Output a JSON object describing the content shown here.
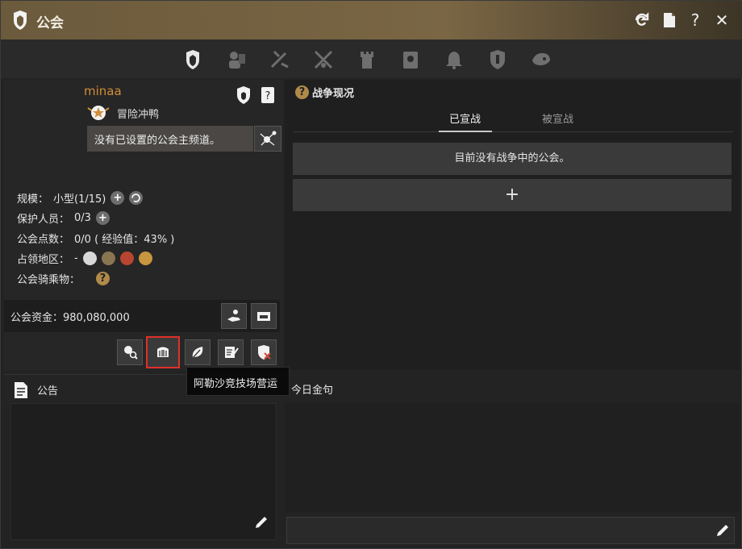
{
  "window": {
    "title": "公会"
  },
  "titlebar": {
    "buttons": [
      "refresh-icon",
      "document-icon",
      "help-icon",
      "close-icon"
    ],
    "help_label": "?",
    "close_label": "✕"
  },
  "tabs": [
    "guild-info-icon",
    "members-icon",
    "quest-icon",
    "war-icon",
    "castle-icon",
    "contract-icon",
    "notification-icon",
    "shield-icon",
    "mount-icon"
  ],
  "guild": {
    "name": "minaa",
    "rank": "冒险冲鸭",
    "channel_text": "没有已设置的公会主频道。"
  },
  "info": {
    "scale_label": "规模：",
    "scale_value": "小型(1/15)",
    "protect_label": "保护人员：",
    "protect_value": "0/3",
    "points_label": "公会点数：",
    "points_value": "0/0 ( 经验值：43% )",
    "territory_label": "占领地区：",
    "territory_value": "-",
    "mount_label": "公会骑乘物：",
    "mount_help": "?",
    "plus": "+"
  },
  "funds": {
    "label": "公会资金：",
    "value": "980,080,000"
  },
  "tooltip": "阿勒沙竞技场营运",
  "notice": {
    "label": "公告"
  },
  "war": {
    "title": "战争现况",
    "help": "?",
    "tabs": [
      "已宣战",
      "被宣战"
    ],
    "empty_text": "目前没有战争中的公会。",
    "add": "+"
  },
  "quote": {
    "label": "今日金句"
  },
  "colors": {
    "accent": "#d18e38",
    "tooltip_border": "#e0302a",
    "titlebar": "#7a6644"
  }
}
